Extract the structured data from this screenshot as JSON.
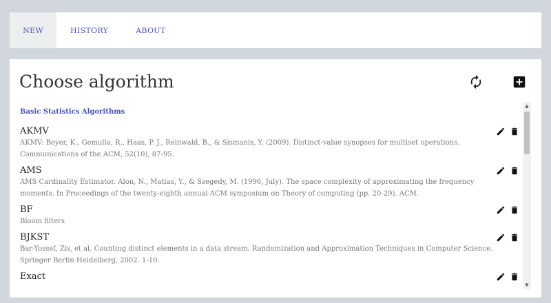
{
  "nav": {
    "tabs": [
      {
        "label": "NEW"
      },
      {
        "label": "HISTORY"
      },
      {
        "label": "ABOUT"
      }
    ]
  },
  "main": {
    "title": "Choose algorithm",
    "section_label": "Basic Statistics Algorithms",
    "refresh_icon": "refresh-icon",
    "add_icon": "add-box-icon",
    "items": [
      {
        "name": "AKMV",
        "desc": "AKMV: Beyer, K., Gemulla, R., Haas, P. J., Reinwald, B., & Sismanis, Y. (2009). Distinct-value synopses for multiset operations. Communications of the ACM, 52(10), 87-95."
      },
      {
        "name": "AMS",
        "desc": "AMS Cardinality Estimator. Alon, N., Matias, Y., & Szegedy, M. (1996, July). The space complexity of approximating the frequency moments. In Proceedings of the twenty-eighth annual ACM symposium on Theory of computing (pp. 20-29). ACM."
      },
      {
        "name": "BF",
        "desc": "Bloom filters"
      },
      {
        "name": "BJKST",
        "desc": "Bar-Yossef, Ziv, et al. Counting distinct elements in a data stream. Randomization and Approximation Techniques in Computer Science. Springer Berlin Heidelberg, 2002. 1-10."
      },
      {
        "name": "Exact",
        "desc": ""
      }
    ]
  },
  "colors": {
    "accent": "#4a55b8",
    "background": "#d1d7dc"
  }
}
